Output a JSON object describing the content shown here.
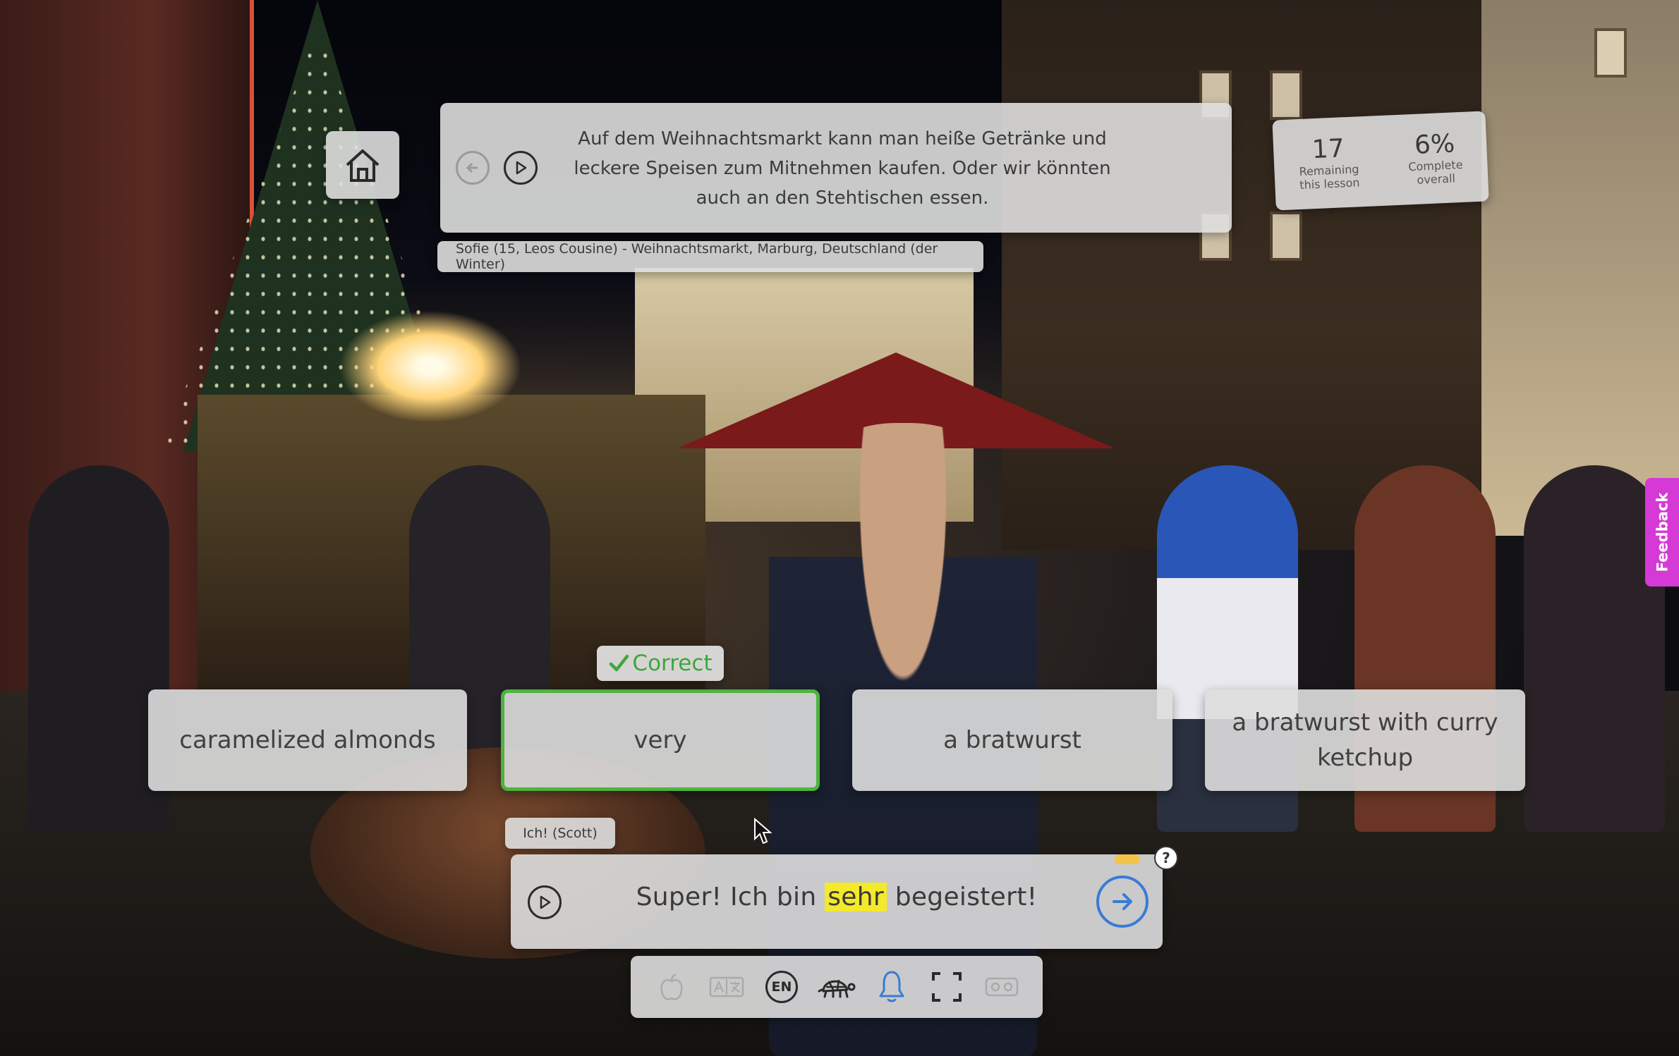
{
  "prompt": {
    "text_lines": [
      "Auf dem Weihnachtsmarkt kann man heiße Getränke und",
      "leckere Speisen zum Mitnehmen kaufen. Oder wir könnten",
      "auch an den Stehtischen essen."
    ],
    "prev_icon": "arrow-left-circle-icon",
    "play_icon": "play-circle-icon"
  },
  "speaker": {
    "label": "Sofie (15, Leos Cousine) - Weihnachtsmarkt, Marburg, Deutschland (der Winter)"
  },
  "progress": {
    "remaining": "17",
    "remaining_label_1": "Remaining",
    "remaining_label_2": "this lesson",
    "complete": "6%",
    "complete_label_1": "Complete",
    "complete_label_2": "overall"
  },
  "feedback_badge": {
    "label": "Correct",
    "color": "#3ea63e"
  },
  "options": [
    {
      "label": "caramelized almonds",
      "selected": false
    },
    {
      "label": "very",
      "selected": true
    },
    {
      "label": "a bratwurst",
      "selected": false
    },
    {
      "label": "a bratwurst with curry ketchup",
      "selected": false
    }
  ],
  "me_tag": {
    "label": "Ich! (Scott)"
  },
  "answer": {
    "before": "Super!  Ich bin ",
    "highlight": "sehr",
    "after": " begeistert!",
    "highlight_color": "#f4e92a"
  },
  "help": {
    "label": "?"
  },
  "toolbar": {
    "icons": [
      "apple-icon",
      "translate-icon",
      "language-en-icon",
      "turtle-icon",
      "bell-icon",
      "fullscreen-icon",
      "vr-headset-icon"
    ],
    "language_label": "EN",
    "bell_color": "#3a7bd5"
  },
  "feedback_tab": {
    "label": "Feedback",
    "color": "#d63ad6"
  }
}
